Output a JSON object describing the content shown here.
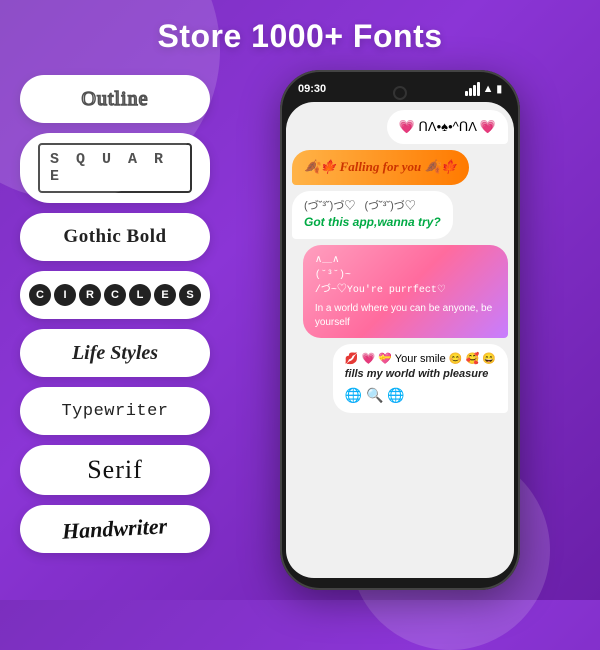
{
  "header": {
    "title": "Store 1000+ Fonts"
  },
  "fonts": [
    {
      "id": "outline",
      "label": "Outline",
      "style": "outline"
    },
    {
      "id": "square",
      "label": "SQUARE",
      "style": "square"
    },
    {
      "id": "gothic",
      "label": "Gothic Bold",
      "style": "gothic"
    },
    {
      "id": "circles",
      "label": "CIRCLES",
      "style": "circles"
    },
    {
      "id": "lifestyle",
      "label": "Life Styles",
      "style": "lifestyle"
    },
    {
      "id": "typewriter",
      "label": "Typewriter",
      "style": "typewriter"
    },
    {
      "id": "serif",
      "label": "Serif",
      "style": "serif"
    },
    {
      "id": "handwriter",
      "label": "Handwriter",
      "style": "handwriter"
    }
  ],
  "phone": {
    "time": "09:30",
    "bubbles": [
      {
        "id": "bubble1",
        "text": "💗 ՈΛ•♠•^ՈΛ 💗",
        "type": "right"
      },
      {
        "id": "bubble2",
        "text": "🍂🍁 Falling for you 🍂🍁",
        "type": "orange"
      },
      {
        "id": "bubble3a",
        "text": "(づ˘³˘)づ♡  (づ˘³˘)づ♡",
        "type": "white-green"
      },
      {
        "id": "bubble3b",
        "text": "Got this app,wanna try?",
        "type": "green-italic"
      },
      {
        "id": "bubble4",
        "text": "∧＿∧\n(˘³˘)~\n/づ~♡You're purrfect♡\nIn a world where you can be anyone, be yourself",
        "type": "pink"
      },
      {
        "id": "bubble5",
        "text": "💋 💗 💝 Your smile 😊 🥰 😄\nfills my world with pleasure\n🌐 🔍 🌐",
        "type": "last"
      }
    ]
  },
  "colors": {
    "background": "#8B35D6",
    "pill_bg": "#ffffff",
    "phone_bg": "#1a1a1a",
    "screen_bg": "#f0f0f0"
  }
}
